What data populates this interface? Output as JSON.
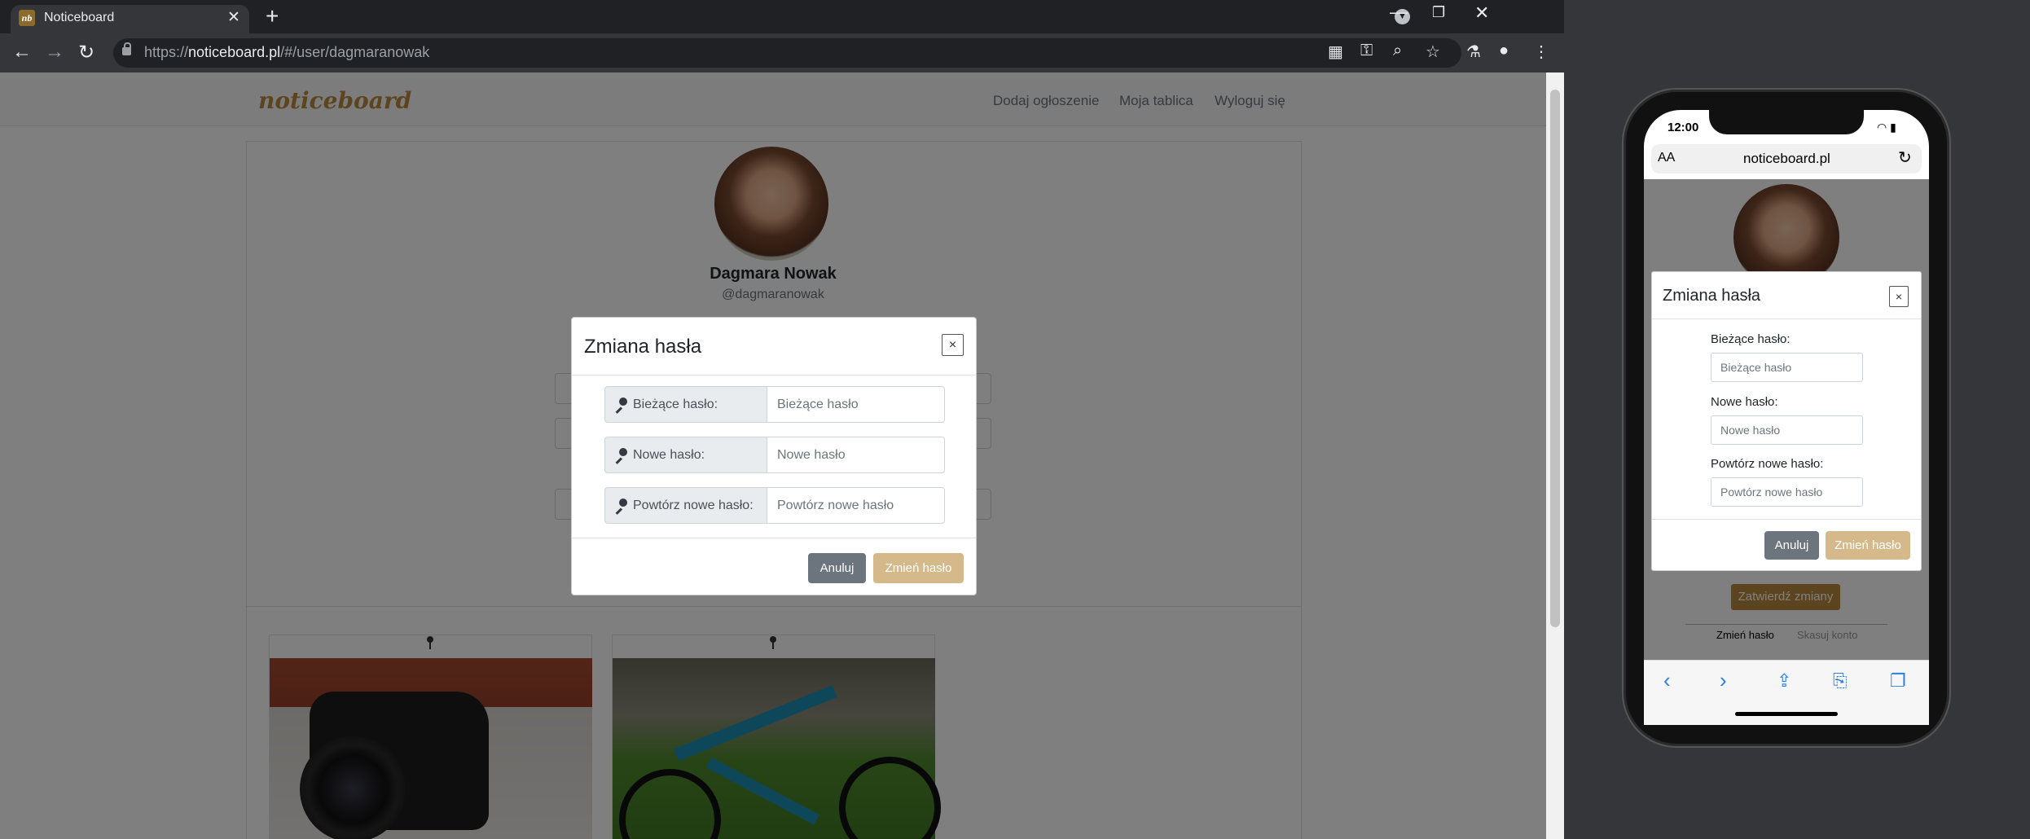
{
  "browser": {
    "tab_title": "Noticeboard",
    "favicon_text": "nb",
    "url_prefix": "https://",
    "url_host": "noticeboard.pl",
    "url_path": "/#/user/dagmaranowak"
  },
  "navbar": {
    "brand": "noticeboard",
    "links": [
      "Dodaj ogłoszenie",
      "Moja tablica",
      "Wyloguj się"
    ]
  },
  "profile": {
    "name": "Dagmara Nowak",
    "handle": "@dagmaranowak"
  },
  "modal": {
    "title": "Zmiana hasła",
    "close": "×",
    "fields": [
      {
        "label": "Bieżące hasło:",
        "placeholder": "Bieżące hasło"
      },
      {
        "label": "Nowe hasło:",
        "placeholder": "Nowe hasło"
      },
      {
        "label": "Powtórz nowe hasło:",
        "placeholder": "Powtórz nowe hasło"
      }
    ],
    "cancel": "Anuluj",
    "submit": "Zmień hasło"
  },
  "phone": {
    "time": "12:00",
    "aa": "AA",
    "url": "noticeboard.pl",
    "confirm": "Zatwierdź zmiany",
    "link_change": "Zmień hasło",
    "link_delete": "Skasuj konto",
    "modal": {
      "title": "Zmiana hasła",
      "close": "×",
      "fields": [
        {
          "label": "Bieżące hasło:",
          "placeholder": "Bieżące hasło"
        },
        {
          "label": "Nowe hasło:",
          "placeholder": "Nowe hasło"
        },
        {
          "label": "Powtórz nowe hasło:",
          "placeholder": "Powtórz nowe hasło"
        }
      ],
      "cancel": "Anuluj",
      "submit": "Zmień hasło"
    }
  },
  "icons": {
    "back": "back-arrow-icon",
    "forward": "forward-arrow-icon",
    "reload": "reload-icon",
    "key": "key-icon"
  },
  "colors": {
    "brand": "#b98a3d",
    "submit_disabled": "#d6b98a",
    "secondary": "#6c757d"
  }
}
